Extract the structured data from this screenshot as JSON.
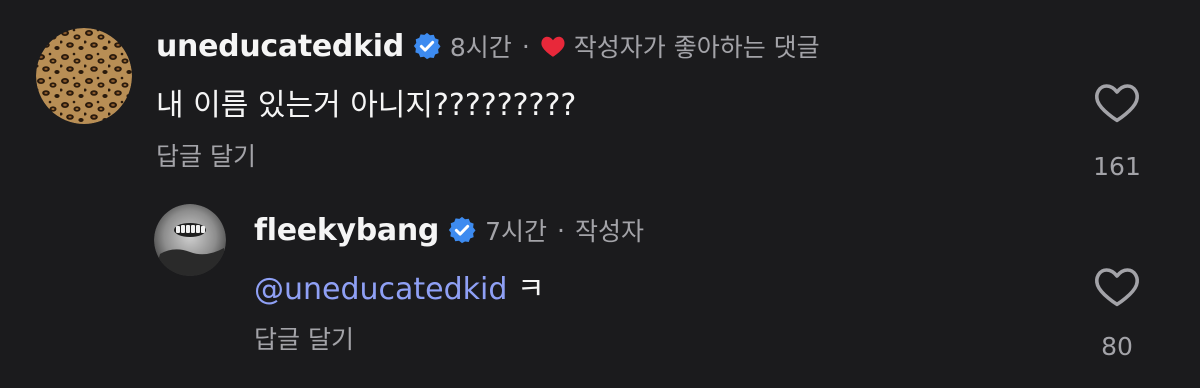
{
  "comments": [
    {
      "username": "uneducatedkid",
      "time": "8시간",
      "separator": "·",
      "liked_by_author_label": "작성자가 좋아하는 댓글",
      "text": "내 이름 있는거 아니지?????????",
      "reply_label": "답글 달기",
      "like_count": "161"
    },
    {
      "username": "fleekybang",
      "time": "7시간",
      "separator": "·",
      "author_label": "작성자",
      "mention": "@uneducatedkid",
      "text": " ㅋ",
      "reply_label": "답글 달기",
      "like_count": "80"
    }
  ],
  "colors": {
    "background": "#1b1b1d",
    "verified": "#3d8bf0",
    "liked_heart": "#e8283a",
    "mention": "#8fa0f5",
    "muted_text": "#a3a3a8"
  },
  "icons": [
    "verified-badge-icon",
    "red-heart-icon",
    "heart-outline-icon"
  ]
}
